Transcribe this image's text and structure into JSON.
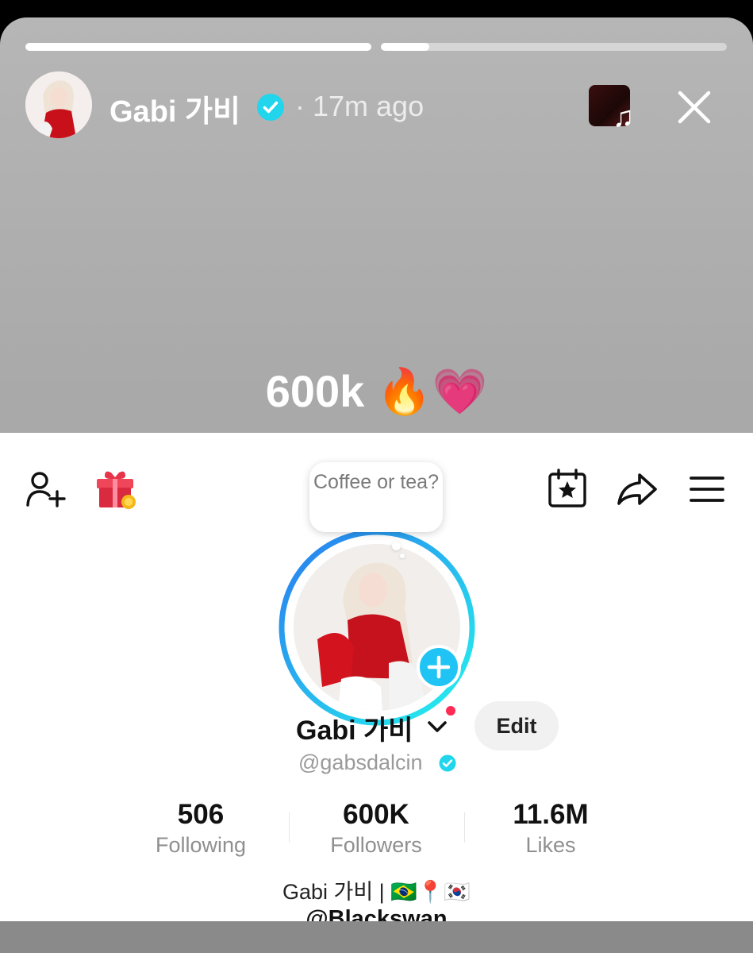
{
  "story": {
    "progress": [
      1.0,
      0.14
    ],
    "author_name": "Gabi 가비",
    "time": "· 17m ago",
    "caption": "600k 🔥💗"
  },
  "profile": {
    "note": "Coffee or tea?",
    "display_name": "Gabi 가비",
    "edit_label": "Edit",
    "handle": "@gabsdalcin",
    "stats": [
      {
        "value": "506",
        "label": "Following"
      },
      {
        "value": "600K",
        "label": "Followers"
      },
      {
        "value": "11.6M",
        "label": "Likes"
      }
    ],
    "bio": "Gabi 가비 | 🇧🇷📍🇰🇷",
    "bio_link": "@Blackswan"
  },
  "colors": {
    "verified": "#20d5ec",
    "accent_red": "#fe2c55",
    "ring_start": "#2a7bef",
    "ring_end": "#25f4ee"
  },
  "icons": [
    "add-user-icon",
    "gift-icon",
    "calendar-star-icon",
    "share-icon",
    "menu-icon",
    "plus-icon",
    "chevron-down-icon",
    "music-note-icon",
    "close-icon",
    "verified-icon"
  ]
}
